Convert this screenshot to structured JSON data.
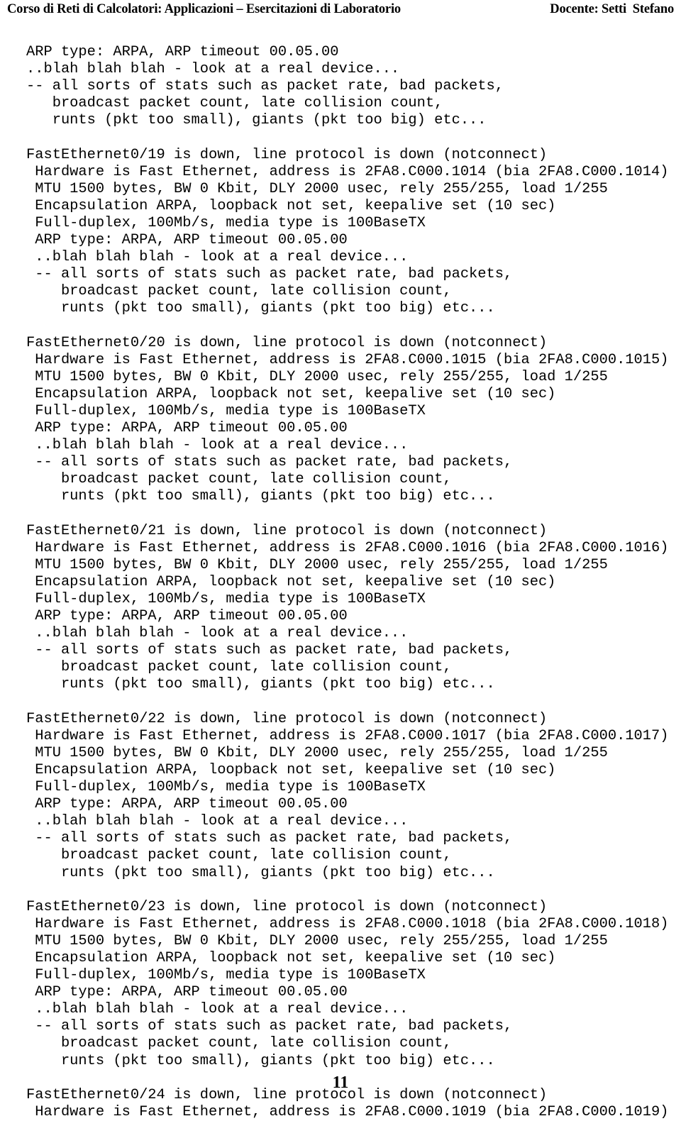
{
  "header": {
    "course_title": "Corso di Reti di Calcolatori: Applicazioni – Esercitazioni di Laboratorio",
    "instructor": "Docente: Setti  Stefano"
  },
  "footer": {
    "page_number": "11"
  },
  "console": {
    "lines": [
      "ARP type: ARPA, ARP timeout 00.05.00",
      "..blah blah blah - look at a real device...",
      "-- all sorts of stats such as packet rate, bad packets,",
      "   broadcast packet count, late collision count,",
      "   runts (pkt too small), giants (pkt too big) etc...",
      "",
      "FastEthernet0/19 is down, line protocol is down (notconnect)",
      " Hardware is Fast Ethernet, address is 2FA8.C000.1014 (bia 2FA8.C000.1014)",
      " MTU 1500 bytes, BW 0 Kbit, DLY 2000 usec, rely 255/255, load 1/255",
      " Encapsulation ARPA, loopback not set, keepalive set (10 sec)",
      " Full-duplex, 100Mb/s, media type is 100BaseTX",
      " ARP type: ARPA, ARP timeout 00.05.00",
      " ..blah blah blah - look at a real device...",
      " -- all sorts of stats such as packet rate, bad packets,",
      "    broadcast packet count, late collision count,",
      "    runts (pkt too small), giants (pkt too big) etc...",
      "",
      "FastEthernet0/20 is down, line protocol is down (notconnect)",
      " Hardware is Fast Ethernet, address is 2FA8.C000.1015 (bia 2FA8.C000.1015)",
      " MTU 1500 bytes, BW 0 Kbit, DLY 2000 usec, rely 255/255, load 1/255",
      " Encapsulation ARPA, loopback not set, keepalive set (10 sec)",
      " Full-duplex, 100Mb/s, media type is 100BaseTX",
      " ARP type: ARPA, ARP timeout 00.05.00",
      " ..blah blah blah - look at a real device...",
      " -- all sorts of stats such as packet rate, bad packets,",
      "    broadcast packet count, late collision count,",
      "    runts (pkt too small), giants (pkt too big) etc...",
      "",
      "FastEthernet0/21 is down, line protocol is down (notconnect)",
      " Hardware is Fast Ethernet, address is 2FA8.C000.1016 (bia 2FA8.C000.1016)",
      " MTU 1500 bytes, BW 0 Kbit, DLY 2000 usec, rely 255/255, load 1/255",
      " Encapsulation ARPA, loopback not set, keepalive set (10 sec)",
      " Full-duplex, 100Mb/s, media type is 100BaseTX",
      " ARP type: ARPA, ARP timeout 00.05.00",
      " ..blah blah blah - look at a real device...",
      " -- all sorts of stats such as packet rate, bad packets,",
      "    broadcast packet count, late collision count,",
      "    runts (pkt too small), giants (pkt too big) etc...",
      "",
      "FastEthernet0/22 is down, line protocol is down (notconnect)",
      " Hardware is Fast Ethernet, address is 2FA8.C000.1017 (bia 2FA8.C000.1017)",
      " MTU 1500 bytes, BW 0 Kbit, DLY 2000 usec, rely 255/255, load 1/255",
      " Encapsulation ARPA, loopback not set, keepalive set (10 sec)",
      " Full-duplex, 100Mb/s, media type is 100BaseTX",
      " ARP type: ARPA, ARP timeout 00.05.00",
      " ..blah blah blah - look at a real device...",
      " -- all sorts of stats such as packet rate, bad packets,",
      "    broadcast packet count, late collision count,",
      "    runts (pkt too small), giants (pkt too big) etc...",
      "",
      "FastEthernet0/23 is down, line protocol is down (notconnect)",
      " Hardware is Fast Ethernet, address is 2FA8.C000.1018 (bia 2FA8.C000.1018)",
      " MTU 1500 bytes, BW 0 Kbit, DLY 2000 usec, rely 255/255, load 1/255",
      " Encapsulation ARPA, loopback not set, keepalive set (10 sec)",
      " Full-duplex, 100Mb/s, media type is 100BaseTX",
      " ARP type: ARPA, ARP timeout 00.05.00",
      " ..blah blah blah - look at a real device...",
      " -- all sorts of stats such as packet rate, bad packets,",
      "    broadcast packet count, late collision count,",
      "    runts (pkt too small), giants (pkt too big) etc...",
      "",
      "FastEthernet0/24 is down, line protocol is down (notconnect)",
      " Hardware is Fast Ethernet, address is 2FA8.C000.1019 (bia 2FA8.C000.1019)"
    ]
  }
}
